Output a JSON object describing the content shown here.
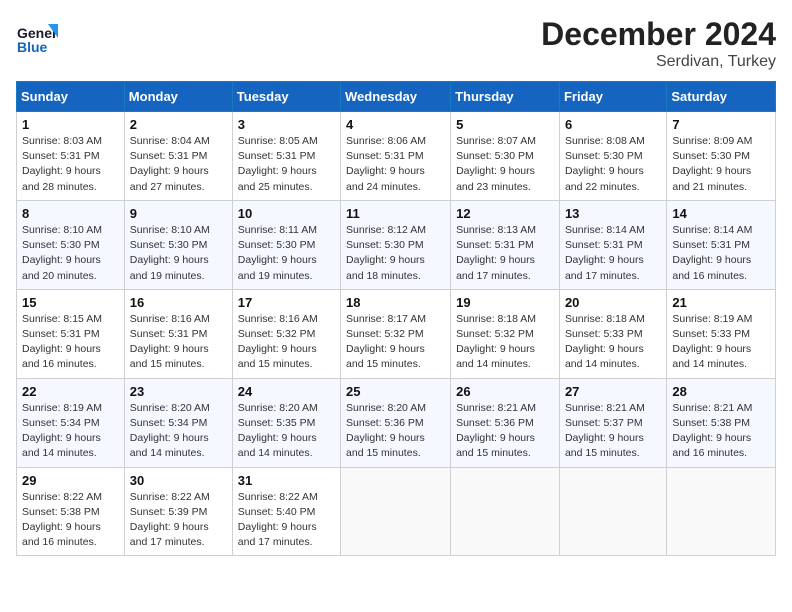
{
  "header": {
    "logo_line1": "General",
    "logo_line2": "Blue",
    "month": "December 2024",
    "location": "Serdivan, Turkey"
  },
  "weekdays": [
    "Sunday",
    "Monday",
    "Tuesday",
    "Wednesday",
    "Thursday",
    "Friday",
    "Saturday"
  ],
  "weeks": [
    [
      {
        "day": "1",
        "sunrise": "8:03 AM",
        "sunset": "5:31 PM",
        "daylight": "9 hours and 28 minutes."
      },
      {
        "day": "2",
        "sunrise": "8:04 AM",
        "sunset": "5:31 PM",
        "daylight": "9 hours and 27 minutes."
      },
      {
        "day": "3",
        "sunrise": "8:05 AM",
        "sunset": "5:31 PM",
        "daylight": "9 hours and 25 minutes."
      },
      {
        "day": "4",
        "sunrise": "8:06 AM",
        "sunset": "5:31 PM",
        "daylight": "9 hours and 24 minutes."
      },
      {
        "day": "5",
        "sunrise": "8:07 AM",
        "sunset": "5:30 PM",
        "daylight": "9 hours and 23 minutes."
      },
      {
        "day": "6",
        "sunrise": "8:08 AM",
        "sunset": "5:30 PM",
        "daylight": "9 hours and 22 minutes."
      },
      {
        "day": "7",
        "sunrise": "8:09 AM",
        "sunset": "5:30 PM",
        "daylight": "9 hours and 21 minutes."
      }
    ],
    [
      {
        "day": "8",
        "sunrise": "8:10 AM",
        "sunset": "5:30 PM",
        "daylight": "9 hours and 20 minutes."
      },
      {
        "day": "9",
        "sunrise": "8:10 AM",
        "sunset": "5:30 PM",
        "daylight": "9 hours and 19 minutes."
      },
      {
        "day": "10",
        "sunrise": "8:11 AM",
        "sunset": "5:30 PM",
        "daylight": "9 hours and 19 minutes."
      },
      {
        "day": "11",
        "sunrise": "8:12 AM",
        "sunset": "5:30 PM",
        "daylight": "9 hours and 18 minutes."
      },
      {
        "day": "12",
        "sunrise": "8:13 AM",
        "sunset": "5:31 PM",
        "daylight": "9 hours and 17 minutes."
      },
      {
        "day": "13",
        "sunrise": "8:14 AM",
        "sunset": "5:31 PM",
        "daylight": "9 hours and 17 minutes."
      },
      {
        "day": "14",
        "sunrise": "8:14 AM",
        "sunset": "5:31 PM",
        "daylight": "9 hours and 16 minutes."
      }
    ],
    [
      {
        "day": "15",
        "sunrise": "8:15 AM",
        "sunset": "5:31 PM",
        "daylight": "9 hours and 16 minutes."
      },
      {
        "day": "16",
        "sunrise": "8:16 AM",
        "sunset": "5:31 PM",
        "daylight": "9 hours and 15 minutes."
      },
      {
        "day": "17",
        "sunrise": "8:16 AM",
        "sunset": "5:32 PM",
        "daylight": "9 hours and 15 minutes."
      },
      {
        "day": "18",
        "sunrise": "8:17 AM",
        "sunset": "5:32 PM",
        "daylight": "9 hours and 15 minutes."
      },
      {
        "day": "19",
        "sunrise": "8:18 AM",
        "sunset": "5:32 PM",
        "daylight": "9 hours and 14 minutes."
      },
      {
        "day": "20",
        "sunrise": "8:18 AM",
        "sunset": "5:33 PM",
        "daylight": "9 hours and 14 minutes."
      },
      {
        "day": "21",
        "sunrise": "8:19 AM",
        "sunset": "5:33 PM",
        "daylight": "9 hours and 14 minutes."
      }
    ],
    [
      {
        "day": "22",
        "sunrise": "8:19 AM",
        "sunset": "5:34 PM",
        "daylight": "9 hours and 14 minutes."
      },
      {
        "day": "23",
        "sunrise": "8:20 AM",
        "sunset": "5:34 PM",
        "daylight": "9 hours and 14 minutes."
      },
      {
        "day": "24",
        "sunrise": "8:20 AM",
        "sunset": "5:35 PM",
        "daylight": "9 hours and 14 minutes."
      },
      {
        "day": "25",
        "sunrise": "8:20 AM",
        "sunset": "5:36 PM",
        "daylight": "9 hours and 15 minutes."
      },
      {
        "day": "26",
        "sunrise": "8:21 AM",
        "sunset": "5:36 PM",
        "daylight": "9 hours and 15 minutes."
      },
      {
        "day": "27",
        "sunrise": "8:21 AM",
        "sunset": "5:37 PM",
        "daylight": "9 hours and 15 minutes."
      },
      {
        "day": "28",
        "sunrise": "8:21 AM",
        "sunset": "5:38 PM",
        "daylight": "9 hours and 16 minutes."
      }
    ],
    [
      {
        "day": "29",
        "sunrise": "8:22 AM",
        "sunset": "5:38 PM",
        "daylight": "9 hours and 16 minutes."
      },
      {
        "day": "30",
        "sunrise": "8:22 AM",
        "sunset": "5:39 PM",
        "daylight": "9 hours and 17 minutes."
      },
      {
        "day": "31",
        "sunrise": "8:22 AM",
        "sunset": "5:40 PM",
        "daylight": "9 hours and 17 minutes."
      },
      null,
      null,
      null,
      null
    ]
  ]
}
